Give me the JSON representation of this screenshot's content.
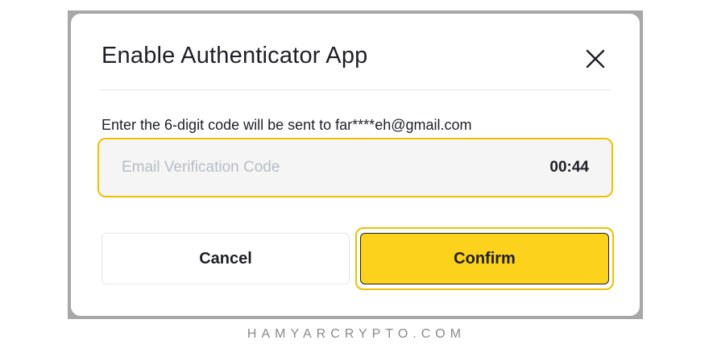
{
  "dialog": {
    "title": "Enable Authenticator App",
    "close_icon": "close-icon",
    "hint": "Enter the 6-digit code will be sent to far****eh@gmail.com",
    "code_input": {
      "placeholder": "Email Verification Code",
      "value": "",
      "timer": "00:44"
    },
    "cancel_label": "Cancel",
    "confirm_label": "Confirm"
  },
  "colors": {
    "accent": "#fcd21d",
    "focus_ring": "#f0c000",
    "text": "#1e2026",
    "placeholder": "#b7bdc6",
    "input_bg": "#f5f5f5"
  },
  "footer": {
    "watermark": "HAMYARCRYPTO.COM"
  }
}
